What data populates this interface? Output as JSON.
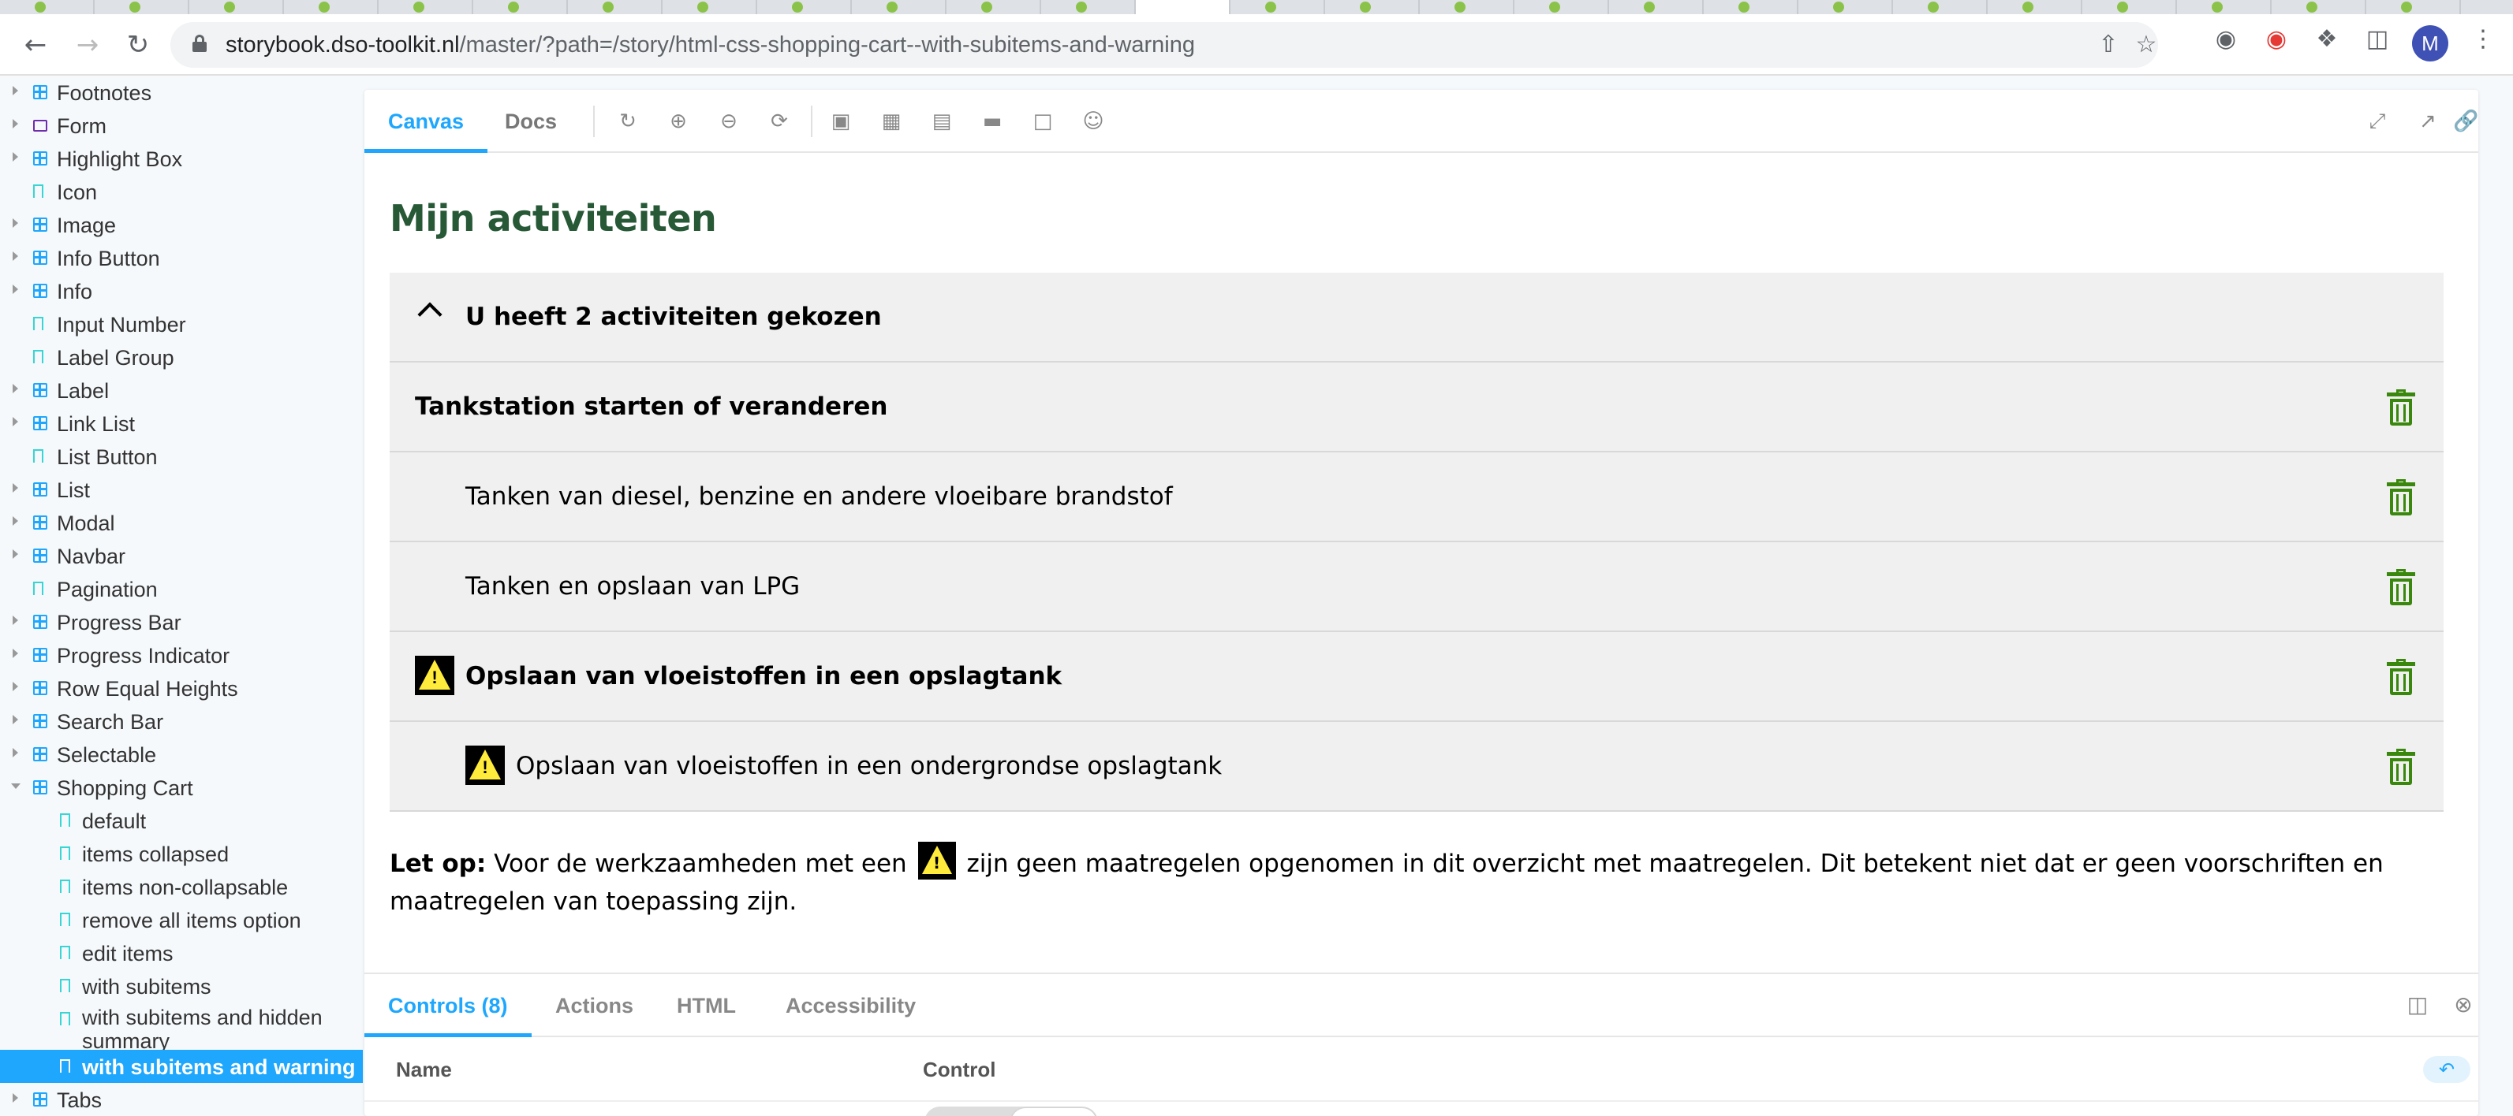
{
  "browser": {
    "url_host": "storybook.dso-toolkit.nl",
    "url_path": "/master/?path=/story/html-css-shopping-cart--with-subitems-and-warning",
    "profile_initial": "M"
  },
  "sidebar": {
    "items": [
      {
        "label": "Footnotes",
        "type": "component"
      },
      {
        "label": "Form",
        "type": "folder"
      },
      {
        "label": "Highlight Box",
        "type": "component"
      },
      {
        "label": "Icon",
        "type": "story"
      },
      {
        "label": "Image",
        "type": "component"
      },
      {
        "label": "Info Button",
        "type": "component"
      },
      {
        "label": "Info",
        "type": "component"
      },
      {
        "label": "Input Number",
        "type": "story"
      },
      {
        "label": "Label Group",
        "type": "story"
      },
      {
        "label": "Label",
        "type": "component"
      },
      {
        "label": "Link List",
        "type": "component"
      },
      {
        "label": "List Button",
        "type": "story"
      },
      {
        "label": "List",
        "type": "component"
      },
      {
        "label": "Modal",
        "type": "component"
      },
      {
        "label": "Navbar",
        "type": "component"
      },
      {
        "label": "Pagination",
        "type": "story"
      },
      {
        "label": "Progress Bar",
        "type": "component"
      },
      {
        "label": "Progress Indicator",
        "type": "component"
      },
      {
        "label": "Row Equal Heights",
        "type": "component"
      },
      {
        "label": "Search Bar",
        "type": "component"
      },
      {
        "label": "Selectable",
        "type": "component"
      },
      {
        "label": "Shopping Cart",
        "type": "component",
        "expanded": true
      }
    ],
    "children": [
      {
        "label": "default"
      },
      {
        "label": "items collapsed"
      },
      {
        "label": "items non-collapsable"
      },
      {
        "label": "remove all items option"
      },
      {
        "label": "edit items"
      },
      {
        "label": "with subitems"
      },
      {
        "label": "with subitems and hidden summary"
      },
      {
        "label": "with subitems and warning",
        "selected": true
      }
    ],
    "after": [
      {
        "label": "Tabs",
        "type": "component"
      }
    ]
  },
  "toolbar": {
    "tab_canvas": "Canvas",
    "tab_docs": "Docs"
  },
  "story": {
    "title": "Mijn activiteiten",
    "summary": "U heeft 2 activiteiten gekozen",
    "rows": [
      {
        "text": "Tankstation starten of veranderen",
        "bold": true,
        "indent": false,
        "warning": false
      },
      {
        "text": "Tanken van diesel, benzine en andere vloeibare brandstof",
        "bold": false,
        "indent": true,
        "warning": false
      },
      {
        "text": "Tanken en opslaan van LPG",
        "bold": false,
        "indent": true,
        "warning": false
      },
      {
        "text": "Opslaan van vloeistoffen in een opslagtank",
        "bold": true,
        "indent": false,
        "warning": true
      },
      {
        "text": "Opslaan van vloeistoffen in een ondergrondse opslagtank",
        "bold": false,
        "indent": true,
        "warning": true
      }
    ],
    "note_lead": "Let op:",
    "note_before": "Voor de werkzaamheden met een",
    "note_after": "zijn geen maatregelen opgenomen in dit overzicht met maatregelen. Dit betekent niet dat er geen voorschriften en maatregelen van toepassing zijn.",
    "warning_mark": "!"
  },
  "addons": {
    "tabs": [
      "Controls (8)",
      "Actions",
      "HTML",
      "Accessibility"
    ],
    "col_name": "Name",
    "col_control": "Control"
  },
  "colors": {
    "accent": "#1ea7fd",
    "title_green": "#275937",
    "trash_green": "#39870c",
    "warning_yellow": "#ffeb3b"
  }
}
